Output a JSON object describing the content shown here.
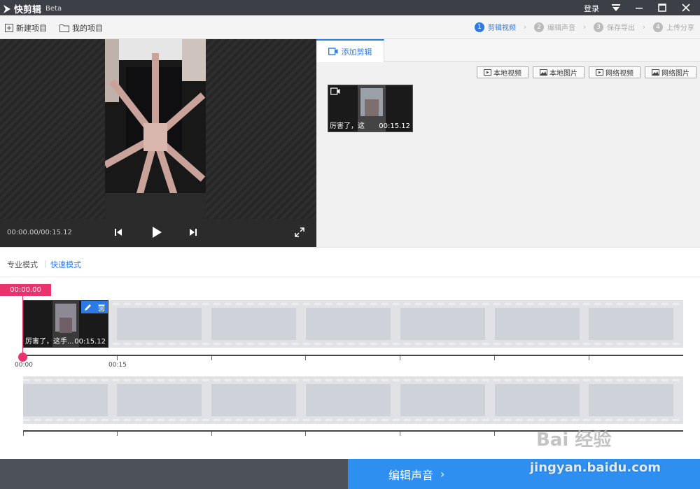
{
  "titlebar": {
    "title": "快剪辑",
    "badge": "Beta",
    "login": "登录"
  },
  "toolbar": {
    "new_project": "新建项目",
    "my_projects": "我的项目"
  },
  "steps": [
    {
      "num": "1",
      "label": "剪辑视频"
    },
    {
      "num": "2",
      "label": "编辑声音"
    },
    {
      "num": "3",
      "label": "保存导出"
    },
    {
      "num": "4",
      "label": "上传分享"
    }
  ],
  "player": {
    "time": "00:00.00/00:15.12"
  },
  "panel": {
    "tab": "添加剪辑",
    "buttons": [
      "本地视频",
      "本地图片",
      "网络视频",
      "网络图片"
    ],
    "thumb": {
      "label": "厉害了，这",
      "duration": "00:15.12"
    }
  },
  "modes": {
    "pro": "专业模式",
    "quick": "快速模式"
  },
  "timeline": {
    "playhead": "00:00.00",
    "clip": {
      "label": "厉害了，这手...",
      "duration": "00:15.12"
    },
    "ruler": [
      "00:00",
      "00:15"
    ]
  },
  "bottom": {
    "next": "编辑声音"
  },
  "watermark": {
    "site": "jingyan.baidu.com",
    "brand": "Bai 经验"
  },
  "colors": {
    "accent": "#2c7be5",
    "playhead": "#e8336d",
    "next": "#2e8ff0"
  }
}
